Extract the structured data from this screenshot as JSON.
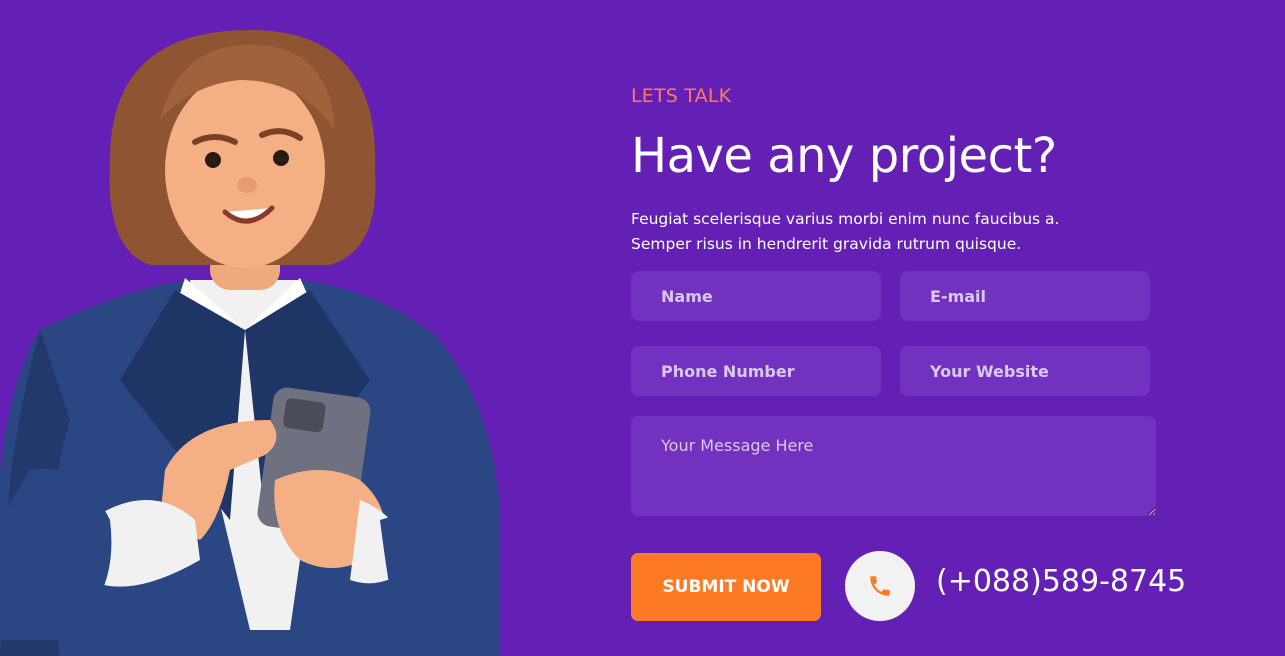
{
  "illustration": {
    "icon": "woman-with-phone-illustration"
  },
  "section": {
    "eyebrow": "LETS TALK",
    "title": "Have any project?",
    "description_line1": "Feugiat scelerisque varius morbi enim nunc faucibus a.",
    "description_line2": "Semper risus in hendrerit gravida rutrum quisque."
  },
  "form": {
    "name_placeholder": "Name",
    "email_placeholder": "E-mail",
    "phone_placeholder": "Phone Number",
    "website_placeholder": "Your Website",
    "message_placeholder": "Your Message Here",
    "submit_label": "SUBMIT NOW"
  },
  "contact": {
    "phone_icon": "phone-icon",
    "phone_number": "(+088)589-8745"
  },
  "colors": {
    "background": "#6420b5",
    "accent": "#ff7a24",
    "eyebrow": "#ff7a59",
    "field": "#7231bf"
  }
}
